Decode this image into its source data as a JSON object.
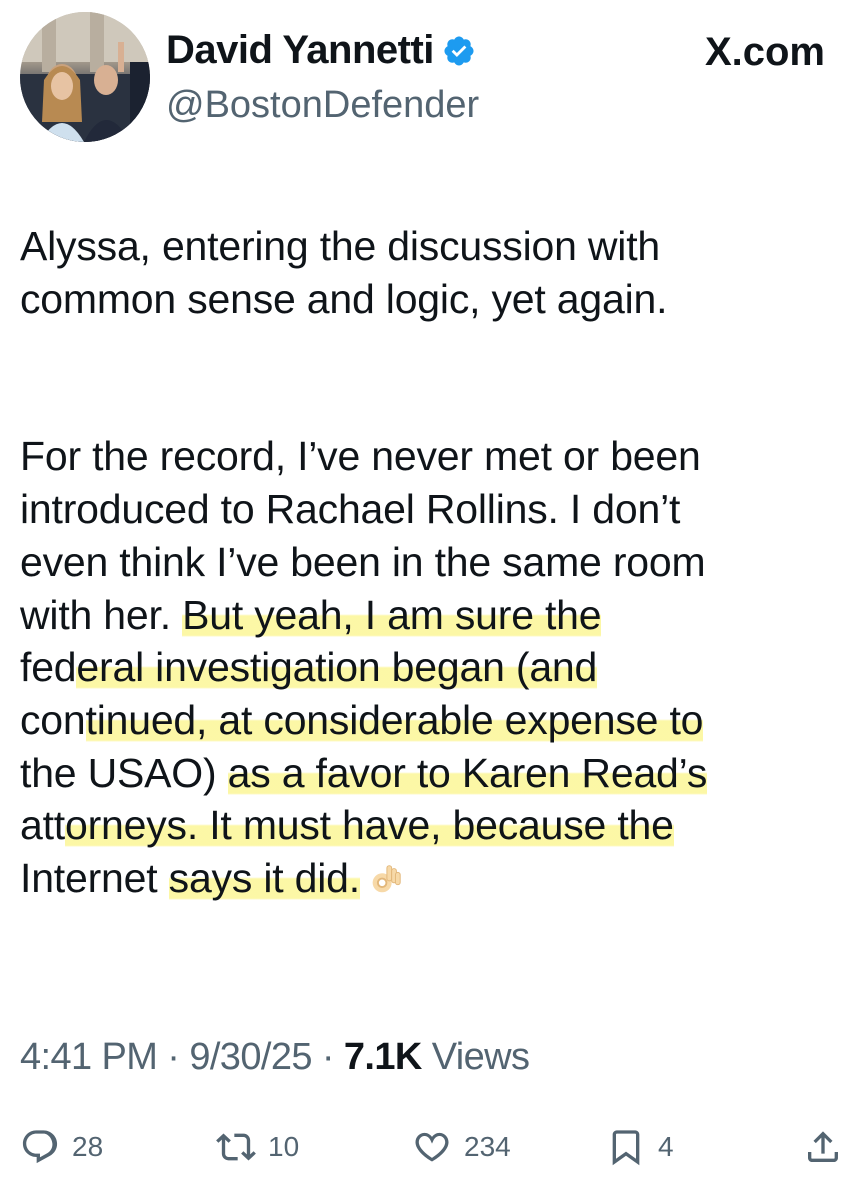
{
  "header": {
    "display_name": "David Yannetti",
    "handle": "@BostonDefender",
    "site_label": "X.com",
    "verified_icon": "verified-badge-icon",
    "accent_color": "#1d9bf0"
  },
  "tweet": {
    "line_1": "Alyssa, entering the discussion with",
    "line_2": "common sense and logic, yet again.",
    "line_3": "For the record, I’ve never met or been",
    "line_4": "introduced to Rachael Rollins. I don’t",
    "line_5": "even think I’ve been in the same room",
    "line_6a": "with her.  ",
    "line_6b": "But yeah, I am sure the",
    "line_7a": "fed",
    "line_7b": "eral investigation began (and",
    "line_8a": "con",
    "line_8b": "tinued, at considerable expense to",
    "line_9a": "the USAO) ",
    "line_9b": "as a favor to Karen Read’s",
    "line_10a": "att",
    "line_10b": "orneys.  It must have, because the",
    "line_11a": "Internet ",
    "line_11b": "says it did.",
    "emoji": "ok-hand-emoji",
    "highlight_color": "#fcf696"
  },
  "meta": {
    "time": "4:41 PM",
    "sep1": " · ",
    "date": "9/30/25",
    "sep2": " · ",
    "views_count": "7.1K",
    "views_label": " Views"
  },
  "actions": {
    "replies": "28",
    "reposts": "10",
    "likes": "234",
    "bookmarks": "4"
  }
}
